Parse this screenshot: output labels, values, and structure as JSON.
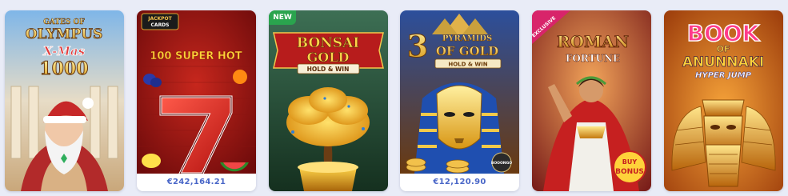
{
  "cards": [
    {
      "title_line1": "GATES OF",
      "title_line2": "OLYMPUS",
      "title_line3": "X-Mas",
      "title_line4": "1000"
    },
    {
      "provider_line1": "JACKPOT",
      "provider_line2": "CARDS",
      "title": "100 SUPER HOT",
      "jackpot": "€242,164.21"
    },
    {
      "badge": "NEW",
      "title_line1": "BONSAI",
      "title_line2": "GOLD",
      "subtitle": "HOLD & WIN"
    },
    {
      "title_number": "3",
      "title_line1": "PYRAMIDS",
      "title_line2": "OF GOLD",
      "subtitle": "HOLD & WIN",
      "provider": "BOOONGO",
      "jackpot": "€12,120.90"
    },
    {
      "badge": "EXCLUSIVE",
      "title_line1": "ROMAN",
      "title_line2": "FORTUNE",
      "feature_line1": "BUY",
      "feature_line2": "BONUS"
    },
    {
      "title_line1": "BOOK",
      "title_line2": "OF",
      "title_line3": "ANUNNAKI",
      "title_line4": "HYPER JUMP"
    }
  ],
  "colors": {
    "background": "#e9ecf7",
    "jackpot_text": "#4a67c8",
    "new_badge": "#2aa44e",
    "exclusive_badge": "#d8246a"
  }
}
